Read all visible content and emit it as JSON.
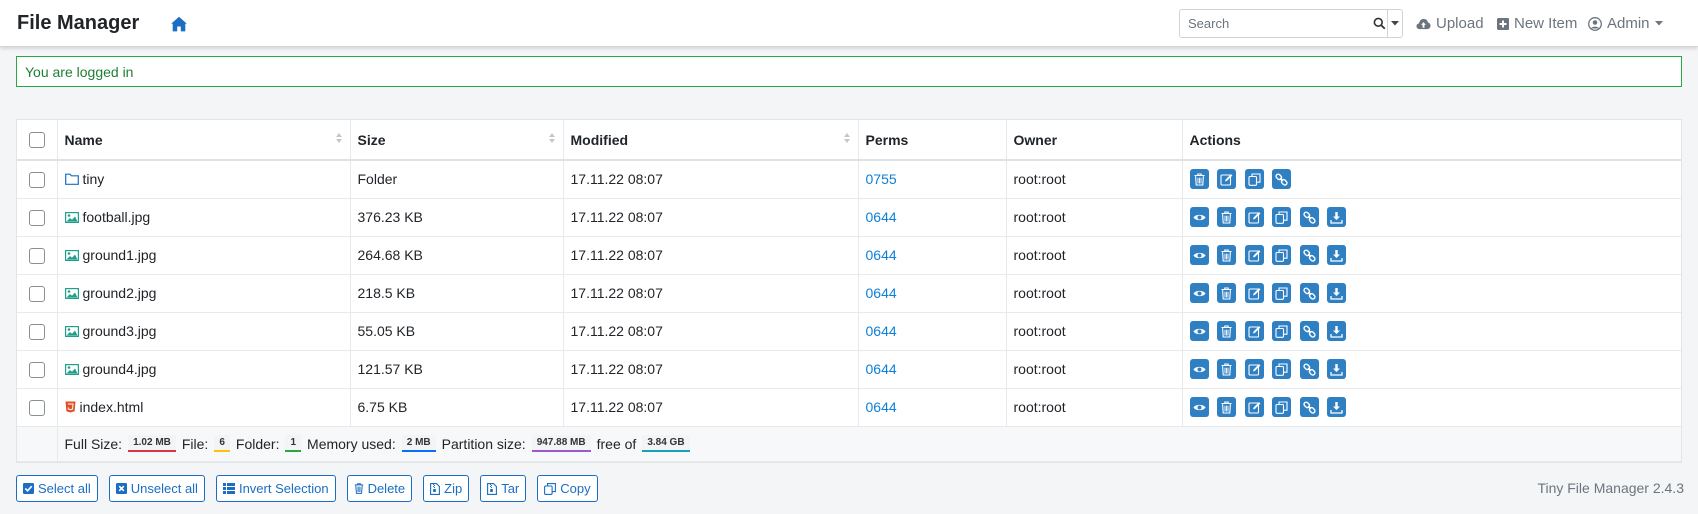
{
  "navbar": {
    "brand": "File Manager",
    "search_placeholder": "Search",
    "upload_label": "Upload",
    "new_item_label": "New Item",
    "user_label": "Admin"
  },
  "alert": {
    "message": "You are logged in"
  },
  "table": {
    "headers": {
      "name": "Name",
      "size": "Size",
      "modified": "Modified",
      "perms": "Perms",
      "owner": "Owner",
      "actions": "Actions"
    },
    "rows": [
      {
        "name": "tiny",
        "type": "folder",
        "size": "Folder",
        "modified": "17.11.22 08:07",
        "perms": "0755",
        "owner": "root:root"
      },
      {
        "name": "football.jpg",
        "type": "image",
        "size": "376.23 KB",
        "modified": "17.11.22 08:07",
        "perms": "0644",
        "owner": "root:root"
      },
      {
        "name": "ground1.jpg",
        "type": "image",
        "size": "264.68 KB",
        "modified": "17.11.22 08:07",
        "perms": "0644",
        "owner": "root:root"
      },
      {
        "name": "ground2.jpg",
        "type": "image",
        "size": "218.5 KB",
        "modified": "17.11.22 08:07",
        "perms": "0644",
        "owner": "root:root"
      },
      {
        "name": "ground3.jpg",
        "type": "image",
        "size": "55.05 KB",
        "modified": "17.11.22 08:07",
        "perms": "0644",
        "owner": "root:root"
      },
      {
        "name": "ground4.jpg",
        "type": "image",
        "size": "121.57 KB",
        "modified": "17.11.22 08:07",
        "perms": "0644",
        "owner": "root:root"
      },
      {
        "name": "index.html",
        "type": "html",
        "size": "6.75 KB",
        "modified": "17.11.22 08:07",
        "perms": "0644",
        "owner": "root:root"
      }
    ],
    "footer": {
      "full_size_label": "Full Size:",
      "full_size": "1.02 MB",
      "file_label": "File:",
      "file_count": "6",
      "folder_label": "Folder:",
      "folder_count": "1",
      "memory_label": "Memory used:",
      "memory": "2 MB",
      "partition_label": "Partition size:",
      "partition": "947.88 MB",
      "free_label": "free of",
      "total": "3.84 GB"
    }
  },
  "bottom": {
    "select_all": "Select all",
    "unselect_all": "Unselect all",
    "invert": "Invert Selection",
    "delete": "Delete",
    "zip": "Zip",
    "tar": "Tar",
    "copy": "Copy"
  },
  "version": "Tiny File Manager 2.4.3",
  "colors": {
    "accent": "#2f7fc3",
    "link": "#0d80d8",
    "success": "#28a745",
    "badge_full_size": "#dc3545",
    "badge_file": "#ffc107",
    "badge_folder": "#28a745",
    "badge_memory": "#0d6efd",
    "badge_partition": "#9b59d0",
    "badge_total": "#17a2b8"
  }
}
